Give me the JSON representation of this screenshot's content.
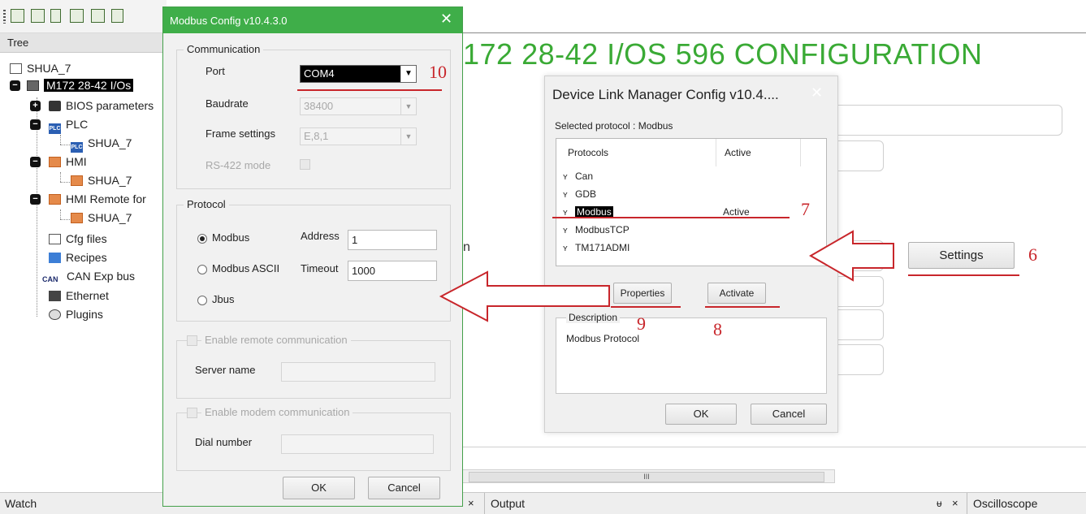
{
  "tree_panel": {
    "header": "Tree",
    "nodes": [
      "SHUA_7",
      "M172 28-42 I/Os",
      "BIOS parameters",
      "PLC",
      "SHUA_7",
      "HMI",
      "SHUA_7",
      "HMI Remote for",
      "SHUA_7",
      "Cfg files",
      "Recipes",
      "CAN Exp bus",
      "Ethernet",
      "Plugins"
    ],
    "plc_icon_text": "PLC",
    "can_icon_text": "CAN"
  },
  "main": {
    "title": "172 28-42 I/OS 596 CONFIGURATION",
    "partial_label": "n",
    "scroll_thumb": "III"
  },
  "bottom_tabs": {
    "watch": "Watch",
    "close_glyph": "×",
    "output": "Output",
    "pin_glyph": "ᵾ",
    "oscilloscope": "Oscilloscope"
  },
  "modbus_dialog": {
    "title": "Modbus Config v10.4.3.0",
    "close": "✕",
    "communication": {
      "group": "Communication",
      "port_label": "Port",
      "port_value": "COM4",
      "baudrate_label": "Baudrate",
      "baudrate_value": "38400",
      "frame_label": "Frame settings",
      "frame_value": "E,8,1",
      "rs422_label": "RS-422 mode"
    },
    "protocol": {
      "group": "Protocol",
      "modbus": "Modbus",
      "modbus_ascii": "Modbus ASCII",
      "jbus": "Jbus",
      "selected": "Modbus",
      "address_label": "Address",
      "address_value": "1",
      "timeout_label": "Timeout",
      "timeout_value": "1000"
    },
    "remote": {
      "enable_label": "Enable remote communication",
      "server_label": "Server name",
      "server_value": ""
    },
    "modem": {
      "enable_label": "Enable modem communication",
      "dial_label": "Dial number",
      "dial_value": ""
    },
    "ok": "OK",
    "cancel": "Cancel"
  },
  "dlm_dialog": {
    "title": "Device Link Manager Config v10.4....",
    "close": "✕",
    "selected_protocol": "Selected protocol :  Modbus",
    "columns": [
      "Protocols",
      "Active"
    ],
    "protocols": [
      {
        "name": "Can",
        "active": ""
      },
      {
        "name": "GDB",
        "active": ""
      },
      {
        "name": "Modbus",
        "active": "Active"
      },
      {
        "name": "ModbusTCP",
        "active": ""
      },
      {
        "name": "TM171ADMI",
        "active": ""
      }
    ],
    "properties_button": "Properties",
    "activate_button": "Activate",
    "description_label": "Description",
    "description_text": "Modbus Protocol",
    "ok": "OK",
    "cancel": "Cancel"
  },
  "settings_button": "Settings",
  "annotations": {
    "n6": "6",
    "n7": "7",
    "n8": "8",
    "n9": "9",
    "n10": "10",
    "color": "#c8262b"
  },
  "colors": {
    "accent_green": "#3fae49",
    "title_green": "#3aaa35"
  }
}
